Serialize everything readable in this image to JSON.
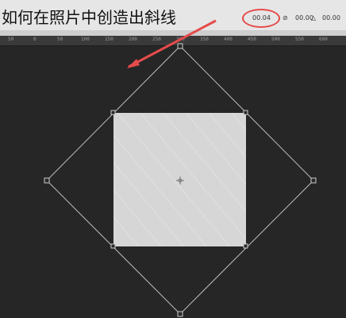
{
  "title": "如何在照片中创造出斜线",
  "options": {
    "x_value": "00.04",
    "angle_value": "00.00",
    "w_value": "00.00",
    "h_value": "00.00"
  },
  "ruler": {
    "numbers": [
      "50",
      "0",
      "50",
      "100",
      "150",
      "200",
      "250",
      "300",
      "350",
      "400",
      "450",
      "500",
      "550",
      "600"
    ]
  },
  "colors": {
    "background": "#262626",
    "selection": "#d6d6d6",
    "annotation": "#e64b4b"
  }
}
